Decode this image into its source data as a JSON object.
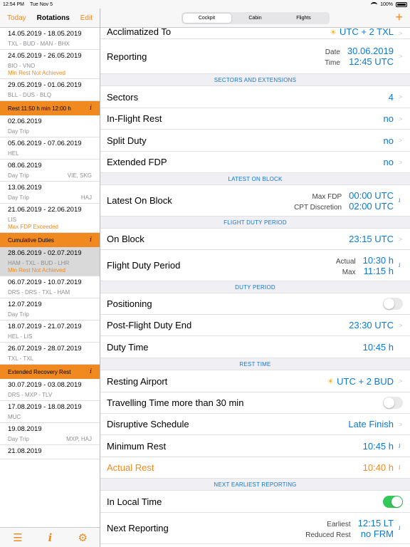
{
  "status": {
    "time": "12:54 PM",
    "date": "Tue Nov 5",
    "battery": "100%"
  },
  "sidebar": {
    "today": "Today",
    "title": "Rotations",
    "edit": "Edit",
    "items": [
      {
        "type": "rot",
        "dates": "14.05.2019  -  18.05.2019",
        "route": "TXL - BUD - MAN - BHX",
        "right": "",
        "warn": ""
      },
      {
        "type": "rot",
        "dates": "24.05.2019  -  26.05.2019",
        "route": "BIO - VNO",
        "right": "",
        "warn": "Min Rest Not Achieved"
      },
      {
        "type": "rot",
        "dates": "29.05.2019  -  01.06.2019",
        "route": "BLL - DUS - BLQ",
        "right": "",
        "warn": ""
      },
      {
        "type": "banner",
        "label": "Rest 11:50 h   min 12:00 h"
      },
      {
        "type": "rot",
        "dates": "02.06.2019",
        "route": "Day Trip",
        "right": "",
        "warn": ""
      },
      {
        "type": "rot",
        "dates": "05.06.2019  -  07.06.2019",
        "route": "HEL",
        "right": "",
        "warn": ""
      },
      {
        "type": "rot",
        "dates": "08.06.2019",
        "route": "Day Trip",
        "right": "VIE, SKG",
        "warn": ""
      },
      {
        "type": "rot",
        "dates": "13.06.2019",
        "route": "Day Trip",
        "right": "HAJ",
        "warn": ""
      },
      {
        "type": "rot",
        "dates": "21.06.2019  -  22.06.2019",
        "route": "LIS",
        "right": "",
        "warn": "Max FDP Exceeded"
      },
      {
        "type": "banner",
        "label": "Cumulative Duties"
      },
      {
        "type": "rot",
        "selected": true,
        "dates": "28.06.2019  -  02.07.2019",
        "route": "HAM - TXL - BUD - LHR",
        "right": "",
        "warn": "Min Rest Not Achieved"
      },
      {
        "type": "rot",
        "dates": "06.07.2019  -  10.07.2019",
        "route": "DRS - DRS - TXL - HAM",
        "right": "",
        "warn": ""
      },
      {
        "type": "rot",
        "dates": "12.07.2019",
        "route": "Day Trip",
        "right": "",
        "warn": ""
      },
      {
        "type": "rot",
        "dates": "18.07.2019  -  21.07.2019",
        "route": "HEL - LIS",
        "right": "",
        "warn": ""
      },
      {
        "type": "rot",
        "dates": "26.07.2019  -  28.07.2019",
        "route": "TXL - TXL",
        "right": "",
        "warn": ""
      },
      {
        "type": "banner",
        "label": "Extended Recovery Rest"
      },
      {
        "type": "rot",
        "dates": "30.07.2019  -  03.08.2019",
        "route": "DRS - MXP - TLV",
        "right": "",
        "warn": ""
      },
      {
        "type": "rot",
        "dates": "17.08.2019  -  18.08.2019",
        "route": "MUC",
        "right": "",
        "warn": ""
      },
      {
        "type": "rot",
        "dates": "19.08.2019",
        "route": "Day Trip",
        "right": "MXP, HAJ",
        "warn": ""
      },
      {
        "type": "rot",
        "dates": "21.08.2019",
        "route": "",
        "right": "",
        "warn": ""
      }
    ],
    "banner_info": "i"
  },
  "tabs": [
    "Cockpit",
    "Cabin",
    "Flights"
  ],
  "active_tab": 0,
  "plus": "+",
  "main": {
    "acclimatized": {
      "label": "Acclimatized To",
      "value": "UTC + 2    TXL"
    },
    "reporting": {
      "label": "Reporting",
      "k1": "Date",
      "v1": "30.06.2019",
      "k2": "Time",
      "v2": "12:45 UTC"
    },
    "sec_sectors": "SECTORS AND EXTENSIONS",
    "sectors": {
      "label": "Sectors",
      "value": "4"
    },
    "inflight": {
      "label": "In-Flight Rest",
      "value": "no"
    },
    "split": {
      "label": "Split Duty",
      "value": "no"
    },
    "extended": {
      "label": "Extended FDP",
      "value": "no"
    },
    "sec_latest": "LATEST ON BLOCK",
    "latest": {
      "label": "Latest On Block",
      "k1": "Max FDP",
      "v1": "00:00 UTC",
      "k2": "CPT Discretion",
      "v2": "02:00 UTC"
    },
    "sec_fdp": "FLIGHT DUTY PERIOD",
    "onblock": {
      "label": "On Block",
      "value": "23:15 UTC"
    },
    "fdp": {
      "label": "Flight Duty Period",
      "k1": "Actual",
      "v1": "10:30 h",
      "k2": "Max",
      "v2": "11:15 h"
    },
    "sec_duty": "DUTY PERIOD",
    "positioning": {
      "label": "Positioning"
    },
    "postflight": {
      "label": "Post-Flight Duty End",
      "value": "23:30 UTC"
    },
    "dutytime": {
      "label": "Duty Time",
      "value": "10:45 h"
    },
    "sec_rest": "REST TIME",
    "resting": {
      "label": "Resting Airport",
      "value": "UTC + 2     BUD"
    },
    "travelling": {
      "label": "Travelling Time more than 30 min"
    },
    "disruptive": {
      "label": "Disruptive Schedule",
      "value": "Late Finish"
    },
    "minrest": {
      "label": "Minimum Rest",
      "value": "10:45 h"
    },
    "actualrest": {
      "label": "Actual Rest",
      "value": "10:40 h"
    },
    "sec_next": "NEXT EARLIEST REPORTING",
    "localtime": {
      "label": "In Local Time"
    },
    "nextrep": {
      "label": "Next Reporting",
      "k1": "Earliest",
      "v1": "12:15 LT",
      "k2": "Reduced Rest",
      "v2": "no FRM"
    }
  },
  "colors": {
    "accent": "#f08a20",
    "blue": "#0a7ad8",
    "green": "#34c759"
  },
  "icons": {
    "chevron": "chevron-right-icon",
    "info": "info-icon",
    "sun": "sun-icon"
  }
}
